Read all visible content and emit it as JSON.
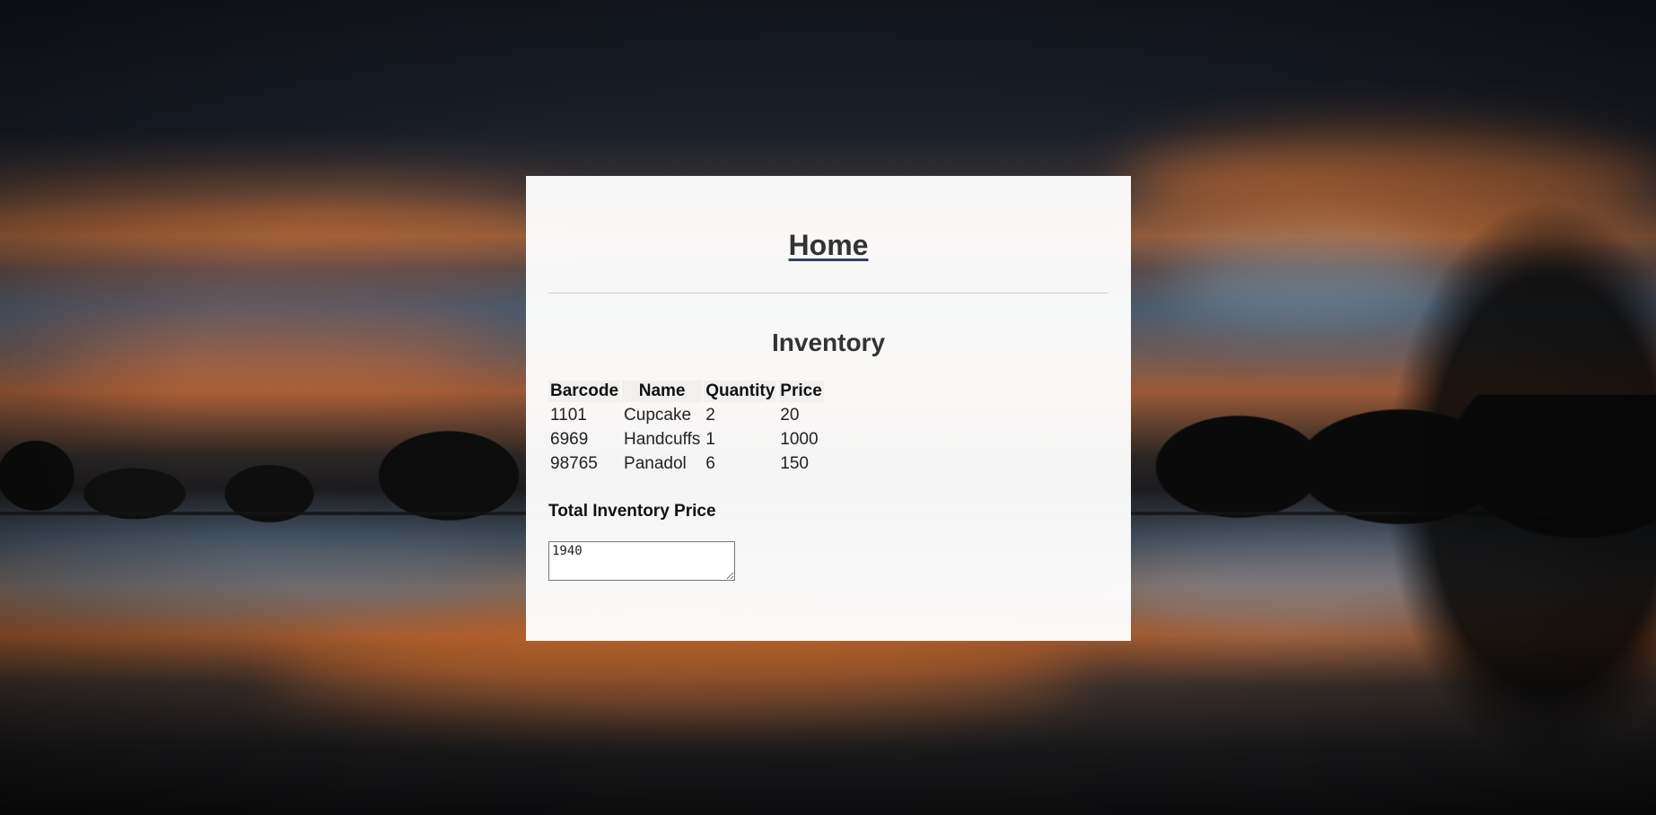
{
  "page": {
    "home_link": "Home",
    "inventory_heading": "Inventory",
    "total_label": "Total Inventory Price",
    "total_value": "1940"
  },
  "table": {
    "headers": [
      "Barcode",
      "Name",
      "Quantity",
      "Price"
    ],
    "rows": [
      [
        "1101",
        "Cupcake",
        "2",
        "20"
      ],
      [
        "6969",
        "Handcuffs",
        "1",
        "1000"
      ],
      [
        "98765",
        "Panadol",
        "6",
        "150"
      ]
    ]
  },
  "colors": {
    "heading_text": "#333333",
    "link_underline": "#2c3e66",
    "panel_background": "#ffffff"
  }
}
